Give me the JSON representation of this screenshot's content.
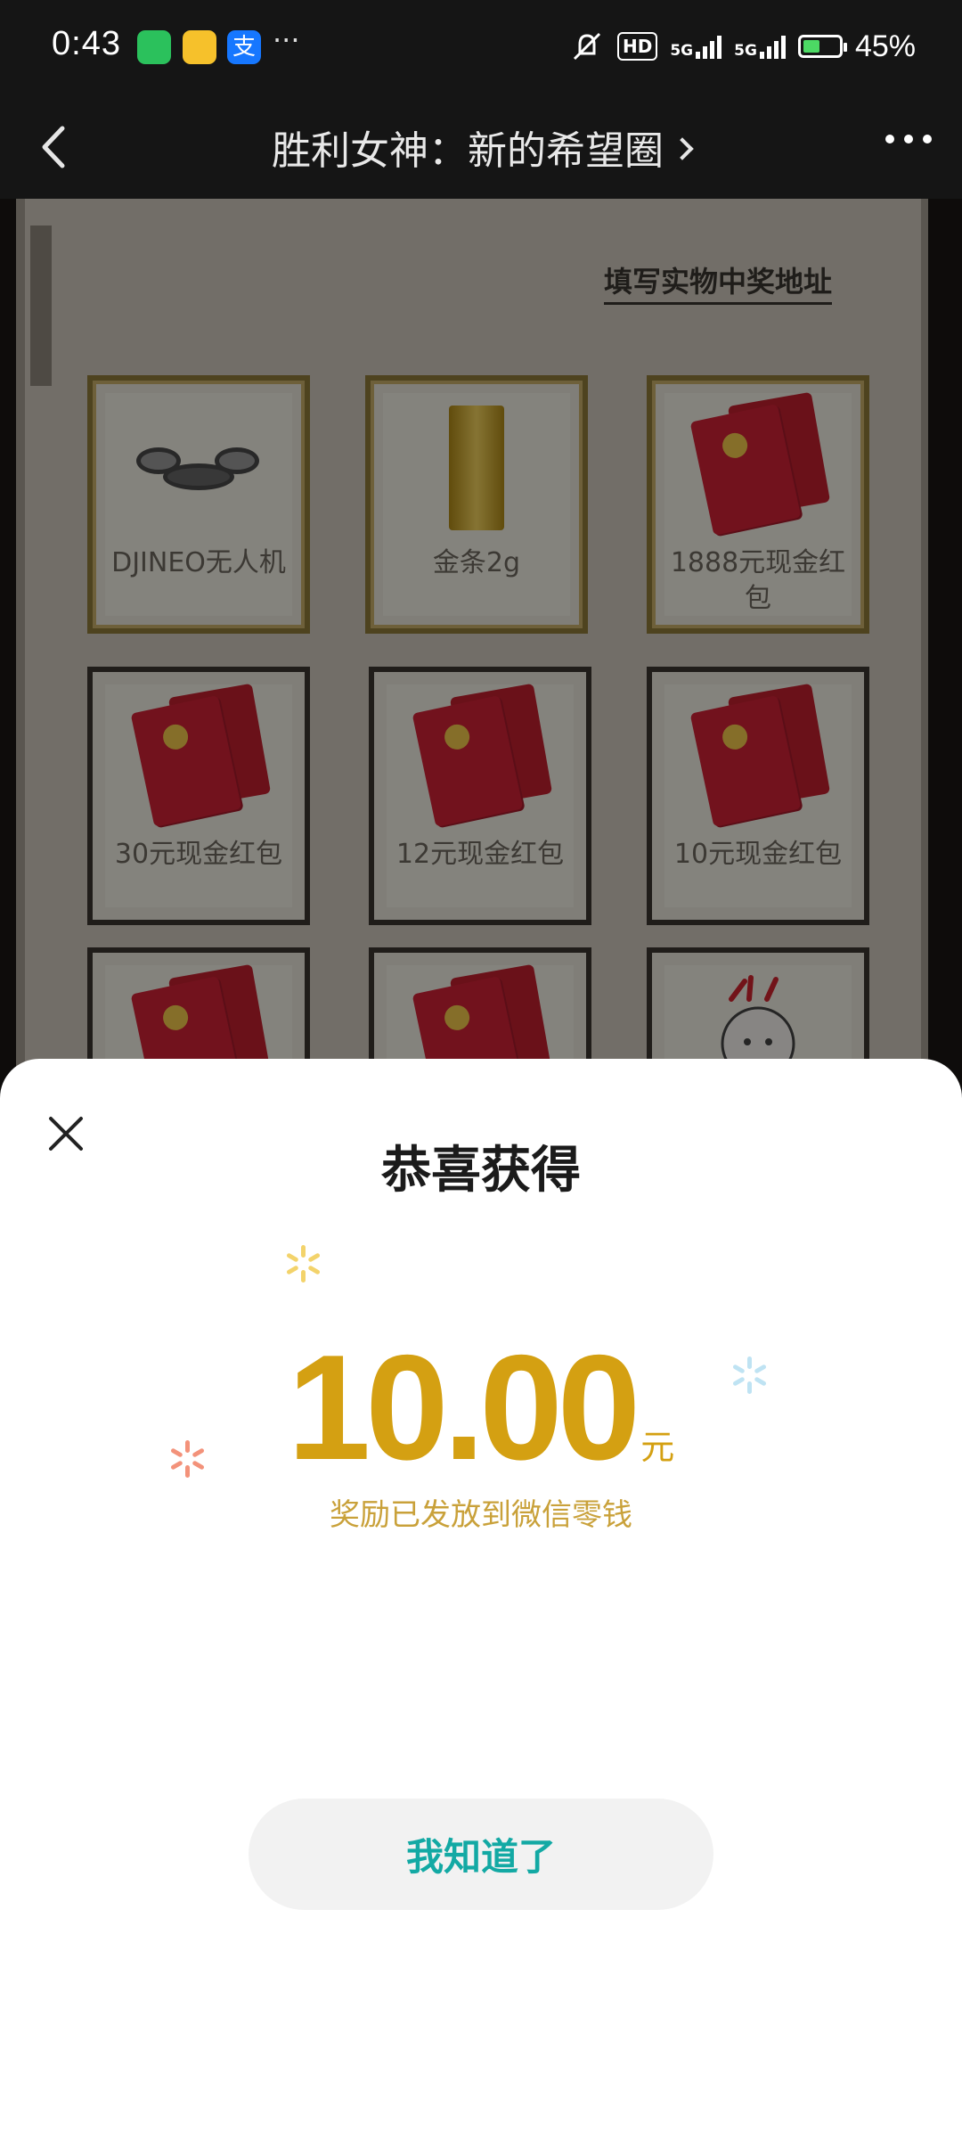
{
  "status_bar": {
    "time": "0:43",
    "more": "···",
    "hd_badge": "HD",
    "network_1": "5G",
    "network_2": "5G",
    "battery": "45%",
    "icons": [
      "wechat-icon",
      "weibo-icon",
      "alipay-icon",
      "mute-icon",
      "signal-icon",
      "battery-charging-icon"
    ]
  },
  "header": {
    "title": "胜利女神：新的希望圈"
  },
  "background_page": {
    "address_link": "填写实物中奖地址",
    "prizes": [
      {
        "label": "DJINEO无人机",
        "type": "drone",
        "tier": "gold"
      },
      {
        "label": "金条2g",
        "type": "gold-bar",
        "tier": "gold"
      },
      {
        "label": "1888元现金红包",
        "type": "red-packet",
        "tier": "gold"
      },
      {
        "label": "30元现金红包",
        "type": "red-packet",
        "tier": "dark"
      },
      {
        "label": "12元现金红包",
        "type": "red-packet",
        "tier": "dark"
      },
      {
        "label": "10元现金红包",
        "type": "red-packet",
        "tier": "dark"
      },
      {
        "label": "",
        "type": "red-packet",
        "tier": "dark"
      },
      {
        "label": "",
        "type": "red-packet",
        "tier": "dark"
      },
      {
        "label": "",
        "type": "sticker",
        "tier": "dark"
      }
    ]
  },
  "dialog": {
    "title": "恭喜获得",
    "amount": "10.00",
    "unit": "元",
    "note": "奖励已发放到微信零钱",
    "confirm_button": "我知道了"
  },
  "colors": {
    "amount": "#d4a012",
    "button_text": "#13a9a4",
    "button_bg": "#f2f2f2",
    "red_packet": "#d02136"
  }
}
